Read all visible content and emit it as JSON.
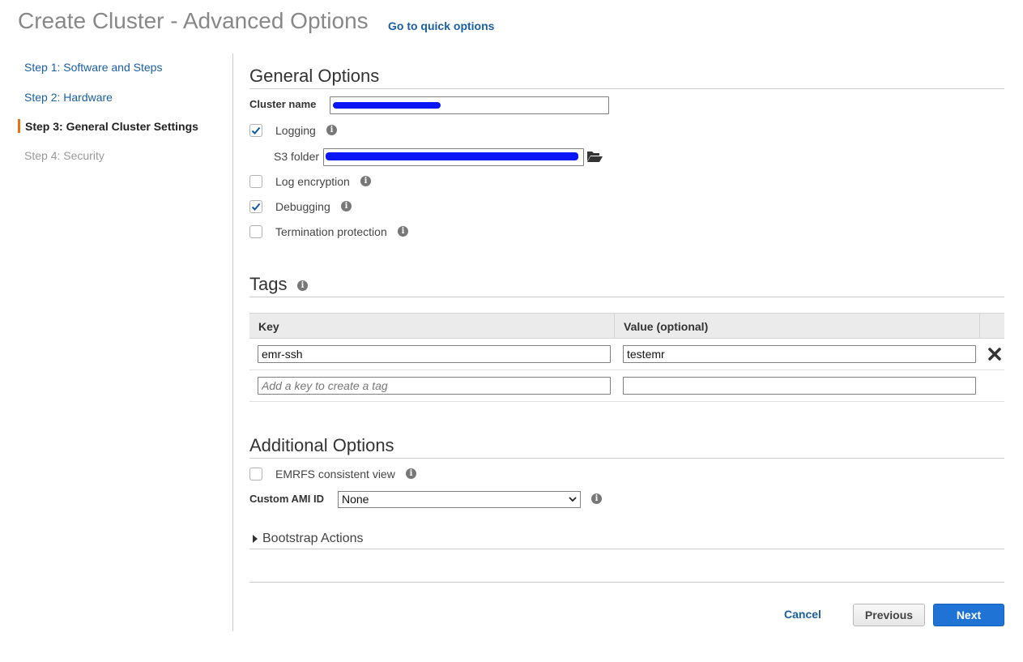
{
  "header": {
    "title": "Create Cluster - Advanced Options",
    "quick_link": "Go to quick options"
  },
  "steps": [
    {
      "label": "Step 1: Software and Steps",
      "state": "link"
    },
    {
      "label": "Step 2: Hardware",
      "state": "link"
    },
    {
      "label": "Step 3: General Cluster Settings",
      "state": "active"
    },
    {
      "label": "Step 4: Security",
      "state": "disabled"
    }
  ],
  "general": {
    "title": "General Options",
    "cluster_name_label": "Cluster name",
    "logging_label": "Logging",
    "logging_checked": true,
    "s3_folder_label": "S3 folder",
    "log_encryption_label": "Log encryption",
    "log_encryption_checked": false,
    "debugging_label": "Debugging",
    "debugging_checked": true,
    "termination_label": "Termination protection",
    "termination_checked": false
  },
  "tags": {
    "title": "Tags",
    "columns": [
      "Key",
      "Value (optional)"
    ],
    "rows": [
      {
        "key": "emr-ssh",
        "value": "testemr"
      }
    ],
    "new_key_placeholder": "Add a key to create a tag"
  },
  "additional": {
    "title": "Additional Options",
    "emrfs_label": "EMRFS consistent view",
    "emrfs_checked": false,
    "ami_label": "Custom AMI ID",
    "ami_value": "None",
    "bootstrap_label": "Bootstrap Actions"
  },
  "footer": {
    "cancel": "Cancel",
    "previous": "Previous",
    "next": "Next"
  },
  "colors": {
    "link": "#1a5fa3",
    "accent": "#ec7211",
    "primary": "#1f73d4",
    "checkmark": "#0e5aa7",
    "redaction": "#0a16f5"
  },
  "icons": {
    "info": "info-icon",
    "folder": "folder-open-icon",
    "remove": "close-icon",
    "caret": "caret-right-icon",
    "dropdown": "chevron-down-icon"
  }
}
